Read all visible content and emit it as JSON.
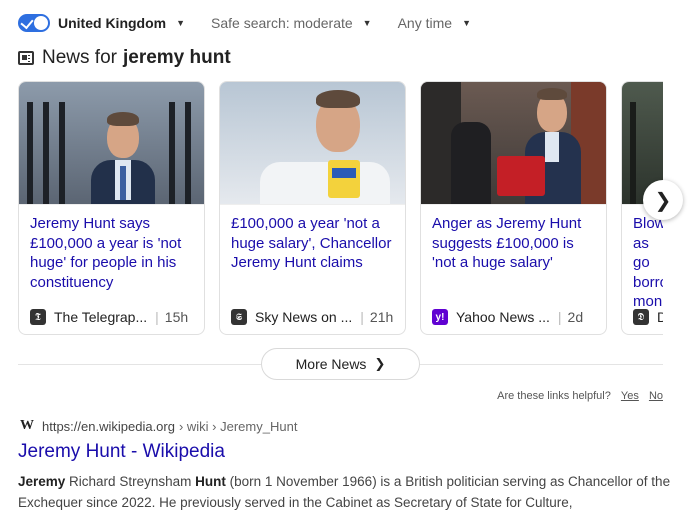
{
  "filters": {
    "safe_search_enabled": true,
    "region": "United Kingdom",
    "safe_search": "Safe search: moderate",
    "time": "Any time"
  },
  "news": {
    "header_prefix": "News for",
    "query": "jeremy hunt",
    "cards": [
      {
        "headline": "Jeremy Hunt says £100,000 a year is 'not huge' for people in his constituency",
        "source": "The Telegrap...",
        "source_icon": "telegraph-icon",
        "age": "15h"
      },
      {
        "headline": "£100,000 a year 'not a huge salary', Chancellor Jeremy Hunt claims",
        "source": "Sky News on ...",
        "source_icon": "sky-news-icon",
        "age": "21h"
      },
      {
        "headline": "Anger as Jeremy Hunt suggests £100,000 is 'not a huge salary'",
        "source": "Yahoo News ...",
        "source_icon": "yahoo-icon",
        "age": "2d"
      },
      {
        "headline": "Blow as go borro mon",
        "source": "D",
        "source_icon": "news-icon",
        "age": ""
      }
    ],
    "next_icon": "chevron-right-icon",
    "more_label": "More News"
  },
  "feedback": {
    "question": "Are these links helpful?",
    "yes": "Yes",
    "no": "No"
  },
  "result": {
    "site_letter": "W",
    "url": "https://en.wikipedia.org",
    "path": "› wiki › Jeremy_Hunt",
    "title": "Jeremy Hunt - Wikipedia",
    "snippet_b1": "Jeremy",
    "snippet_t1": " Richard Streynsham ",
    "snippet_b2": "Hunt",
    "snippet_t2": " (born 1 November 1966) is a British politician serving as Chancellor of the Exchequer since 2022. He previously served in the Cabinet as Secretary of State for Culture,"
  },
  "colors": {
    "link": "#1a0dab",
    "toggle": "#2e6fe0",
    "yahoo": "#6001d2"
  }
}
